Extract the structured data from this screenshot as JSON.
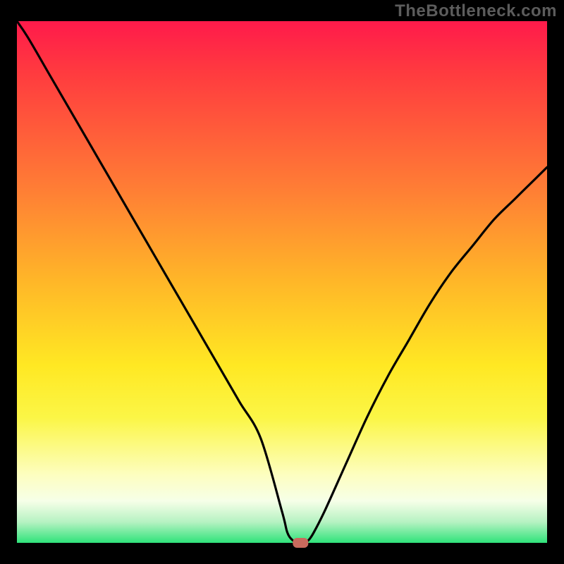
{
  "watermark": "TheBottleneck.com",
  "colors": {
    "background": "#000000",
    "gradient_top": "#ff1a4b",
    "gradient_bottom": "#2fe37a",
    "curve": "#000000",
    "marker": "#c96a5d",
    "watermark_text": "#5c5c5c"
  },
  "chart_data": {
    "type": "line",
    "title": "",
    "xlabel": "",
    "ylabel": "",
    "xlim": [
      0,
      100
    ],
    "ylim": [
      0,
      100
    ],
    "grid": false,
    "legend": false,
    "x": [
      0,
      2,
      6,
      10,
      14,
      18,
      22,
      26,
      30,
      34,
      38,
      42,
      46,
      50,
      51,
      52,
      53,
      54,
      55,
      56,
      58,
      62,
      66,
      70,
      74,
      78,
      82,
      86,
      90,
      94,
      98,
      100
    ],
    "y": [
      100,
      97,
      90,
      83,
      76,
      69,
      62,
      55,
      48,
      41,
      34,
      27,
      20,
      6,
      2,
      0.5,
      0,
      0,
      0.5,
      2,
      6,
      15,
      24,
      32,
      39,
      46,
      52,
      57,
      62,
      66,
      70,
      72
    ],
    "marker": {
      "x": 53.5,
      "y": 0,
      "shape": "rounded-rect"
    },
    "annotations": []
  }
}
